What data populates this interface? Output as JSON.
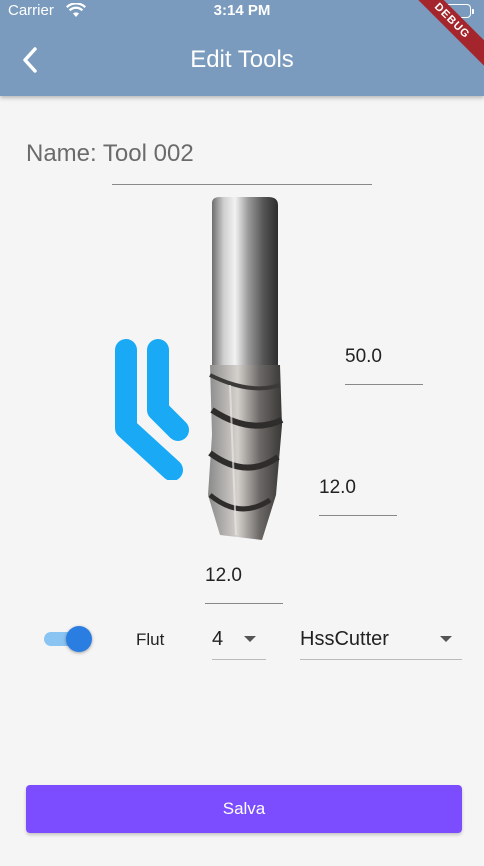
{
  "status_bar": {
    "carrier": "Carrier",
    "time": "3:14 PM"
  },
  "debug_banner": "DEBUG",
  "app_bar": {
    "title": "Edit Tools",
    "back_icon": "chevron-left-icon"
  },
  "form": {
    "name_text": "Name: Tool 002",
    "tool_length": "50.0",
    "flute_length": "12.0",
    "diameter": "12.0",
    "flut_label": "Flut",
    "flut_value": "4",
    "cutter_type": "HssCutter",
    "toggle_on": true
  },
  "save_button": "Salva",
  "colors": {
    "app_bar": "#7a9bbd",
    "accent": "#7c4dff",
    "toggle": "#2a7de1",
    "logo": "#1aa9f5"
  }
}
